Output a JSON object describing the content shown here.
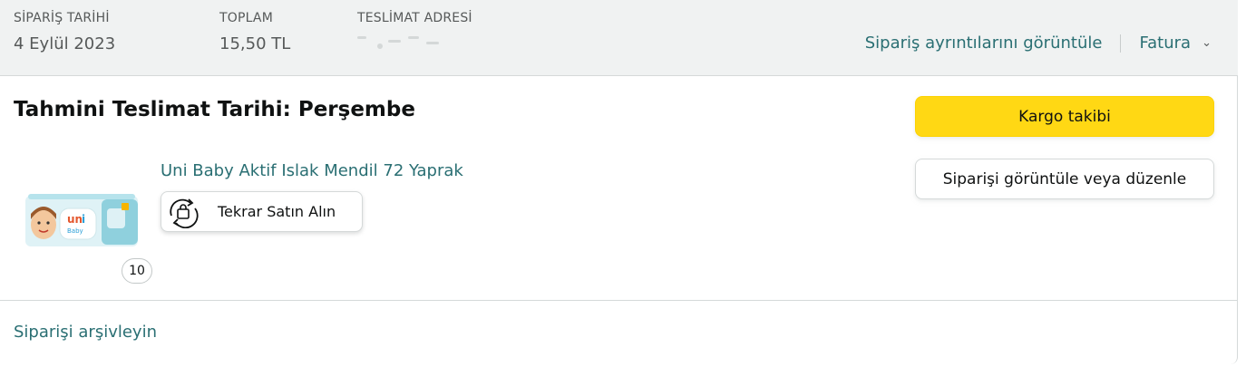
{
  "header": {
    "order_date_label": "SİPARİŞ TARİHİ",
    "order_date_value": "4 Eylül 2023",
    "total_label": "TOPLAM",
    "total_value": "15,50 TL",
    "address_label": "TESLİMAT ADRESİ",
    "details_link": "Sipariş ayrıntılarını görüntüle",
    "invoice_link": "Fatura"
  },
  "shipment": {
    "title": "Tahmini Teslimat Tarihi: Perşembe"
  },
  "item": {
    "title": "Uni Baby Aktif Islak Mendil 72 Yaprak",
    "quantity": "10",
    "rebuy_label": "Tekrar Satın Alın",
    "thumbnail_icon": "product-thumbnail",
    "rebuy_icon": "buy-again-icon"
  },
  "actions": {
    "track_label": "Kargo takibi",
    "view_edit_label": "Siparişi görüntüle veya düzenle"
  },
  "footer": {
    "archive_link": "Siparişi arşivleyin"
  },
  "colors": {
    "link": "#2a6f73",
    "primary_button": "#ffd814",
    "header_bg": "#f0f2f2"
  }
}
